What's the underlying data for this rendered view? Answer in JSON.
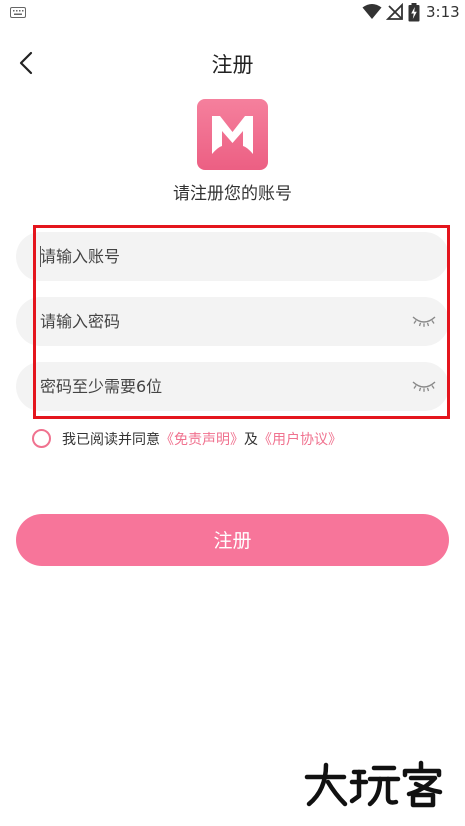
{
  "status_bar": {
    "time": "3:13",
    "icons": [
      "keyboard-icon",
      "wifi-icon",
      "no-signal-icon",
      "battery-charging-icon"
    ]
  },
  "header": {
    "back_icon": "chevron-left-icon",
    "title": "注册"
  },
  "logo": {
    "letter": "M",
    "color": "#f06b8c"
  },
  "subtitle": "请注册您的账号",
  "form": {
    "username": {
      "placeholder": "请输入账号",
      "value": ""
    },
    "password": {
      "placeholder": "请输入密码",
      "value": "",
      "toggle_icon": "eye-closed-icon"
    },
    "confirm": {
      "placeholder": "密码至少需要6位",
      "value": "",
      "toggle_icon": "eye-closed-icon"
    }
  },
  "agreement": {
    "checked": false,
    "prefix": "我已阅读并同意",
    "disclaimer_link": "《免责声明》",
    "conjunction": "及",
    "user_agreement_link": "《用户协议》"
  },
  "register_button": {
    "label": "注册"
  },
  "watermark": {
    "text": "大玩客"
  },
  "colors": {
    "accent": "#f7759a",
    "link": "#f0728f",
    "highlight": "#e4151d",
    "field_bg": "#f3f3f3"
  }
}
